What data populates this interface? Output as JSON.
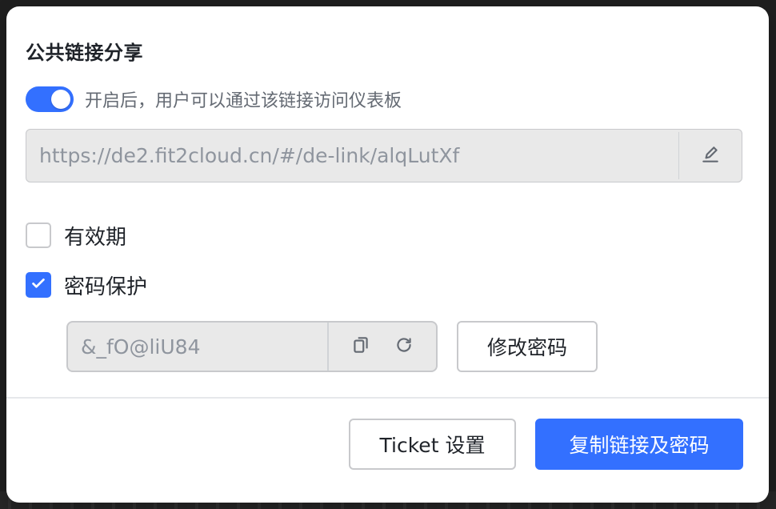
{
  "dialog": {
    "title": "公共链接分享",
    "toggle": {
      "enabled": true,
      "label": "开启后，用户可以通过该链接访问仪表板"
    },
    "link": {
      "value": "https://de2.fit2cloud.cn/#/de-link/alqLutXf",
      "edit_icon": "edit-icon"
    },
    "options": {
      "expiry": {
        "label": "有效期",
        "checked": false
      },
      "password_protect": {
        "label": "密码保护",
        "checked": true,
        "password_value": "&_fO@liU84",
        "copy_icon": "copy-icon",
        "refresh_icon": "refresh-icon",
        "change_password_label": "修改密码"
      }
    },
    "footer": {
      "ticket_settings_label": "Ticket 设置",
      "copy_link_and_password_label": "复制链接及密码"
    }
  },
  "colors": {
    "primary": "#3370ff",
    "text": "#1f2329",
    "muted_text": "#646a73",
    "input_bg": "#e9e9e9",
    "border": "#c8c9cc"
  }
}
